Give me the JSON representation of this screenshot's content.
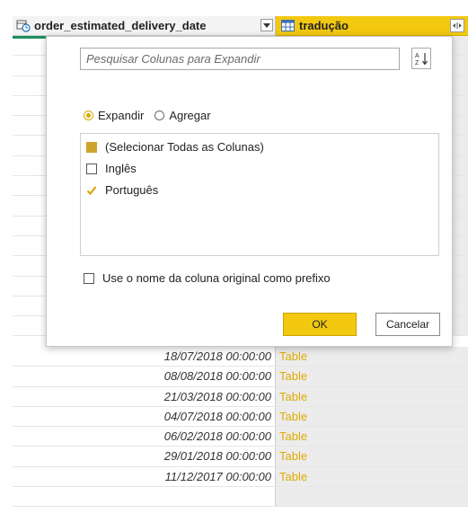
{
  "header": {
    "left_column": "order_estimated_delivery_date",
    "right_column": "tradução"
  },
  "rows": [
    {
      "date": "18/07/2018 00:00:00",
      "value": "Table"
    },
    {
      "date": "08/08/2018 00:00:00",
      "value": "Table"
    },
    {
      "date": "21/03/2018 00:00:00",
      "value": "Table"
    },
    {
      "date": "04/07/2018 00:00:00",
      "value": "Table"
    },
    {
      "date": "06/02/2018 00:00:00",
      "value": "Table"
    },
    {
      "date": "29/01/2018 00:00:00",
      "value": "Table"
    },
    {
      "date": "11/12/2017 00:00:00",
      "value": "Table"
    }
  ],
  "popup": {
    "search_placeholder": "Pesquisar Colunas para Expandir",
    "radio_expand": "Expandir",
    "radio_aggregate": "Agregar",
    "selected_mode": "Expandir",
    "items": [
      {
        "label": "(Selecionar Todas as Colunas)",
        "state": "partial"
      },
      {
        "label": "Inglês",
        "state": "unchecked"
      },
      {
        "label": "Português",
        "state": "checked"
      }
    ],
    "prefix_label": "Use o nome da coluna original como prefixo",
    "ok_label": "OK",
    "cancel_label": "Cancelar"
  },
  "colors": {
    "accent": "#f2c811",
    "table_text": "#e0ab00"
  }
}
